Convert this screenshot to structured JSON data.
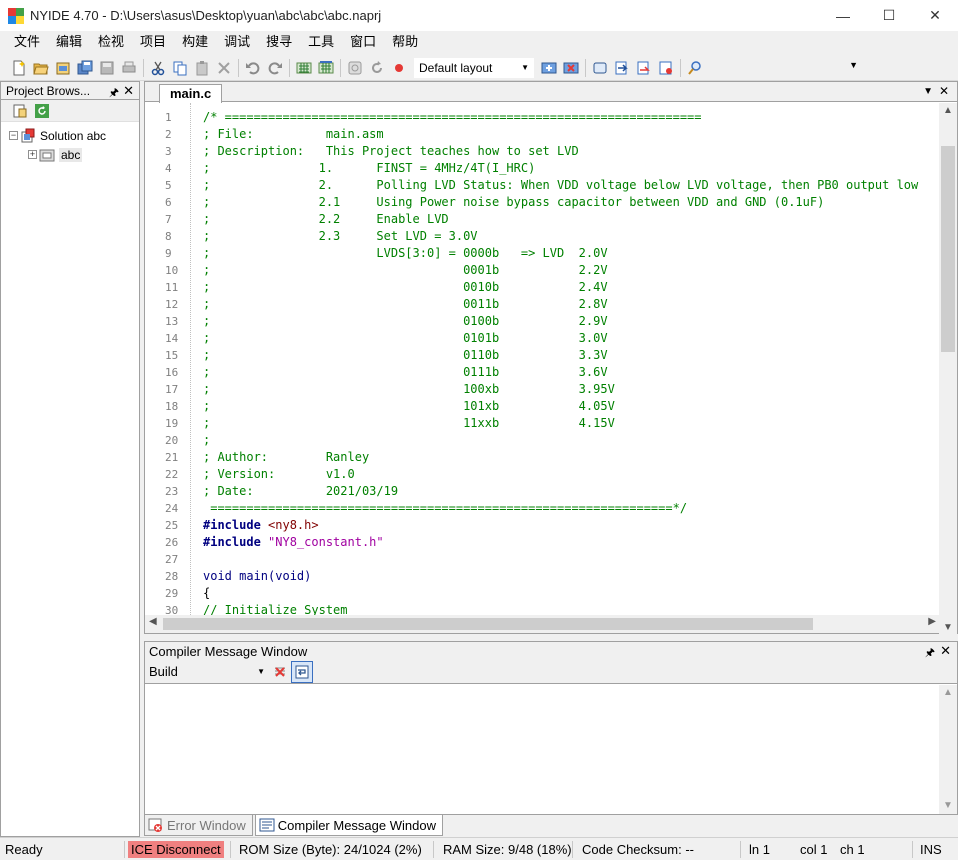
{
  "window": {
    "title": "NYIDE 4.70 - D:\\Users\\asus\\Desktop\\yuan\\abc\\abc\\abc.naprj",
    "minimize": "—",
    "maximize": "☐",
    "close": "✕"
  },
  "menu": [
    "文件",
    "编辑",
    "检视",
    "项目",
    "构建",
    "调试",
    "搜寻",
    "工具",
    "窗口",
    "帮助"
  ],
  "toolbar": {
    "layout_select": "Default layout",
    "icons": [
      "new-file-icon",
      "open-folder-icon",
      "open-project-icon",
      "save-all-icon",
      "save-icon",
      "print-icon",
      "cut-icon",
      "copy-icon",
      "paste-icon",
      "delete-icon",
      "undo-icon",
      "redo-icon",
      "build-icon",
      "rebuild-icon",
      "stop-icon",
      "reset-icon",
      "record-icon",
      "layout-save-icon",
      "layout-delete-icon",
      "window-icon",
      "step-into-icon",
      "step-over-icon",
      "step-out-icon",
      "find-icon"
    ]
  },
  "project_browser": {
    "title": "Project Brows...",
    "pin": "🖈",
    "close": "✕",
    "tree": [
      {
        "label": "Solution abc",
        "expander": "−"
      },
      {
        "label": "abc",
        "expander": "+"
      }
    ]
  },
  "editor": {
    "tab_label": "main.c",
    "tab_dropdown": "▼",
    "tab_close": "✕",
    "lines": [
      {
        "n": "1",
        "parts": [
          {
            "t": "/* ==================================================================",
            "c": "cm"
          }
        ]
      },
      {
        "n": "2",
        "parts": [
          {
            "t": "; File:          main.asm",
            "c": "cm"
          }
        ]
      },
      {
        "n": "3",
        "parts": [
          {
            "t": "; Description:   This Project teaches how to set LVD",
            "c": "cm"
          }
        ]
      },
      {
        "n": "4",
        "parts": [
          {
            "t": ";               1.      FINST = 4MHz/4T(I_HRC)",
            "c": "cm"
          }
        ]
      },
      {
        "n": "5",
        "parts": [
          {
            "t": ";               2.      Polling LVD Status: When VDD voltage below LVD voltage, then PB0 output low",
            "c": "cm"
          }
        ]
      },
      {
        "n": "6",
        "parts": [
          {
            "t": ";               2.1     Using Power noise bypass capacitor between VDD and GND (0.1uF)",
            "c": "cm"
          }
        ]
      },
      {
        "n": "7",
        "parts": [
          {
            "t": ";               2.2     Enable LVD",
            "c": "cm"
          }
        ]
      },
      {
        "n": "8",
        "parts": [
          {
            "t": ";               2.3     Set LVD = 3.0V",
            "c": "cm"
          }
        ]
      },
      {
        "n": "9",
        "parts": [
          {
            "t": ";                       LVDS[3:0] = 0000b   => LVD  2.0V",
            "c": "cm"
          }
        ]
      },
      {
        "n": "10",
        "parts": [
          {
            "t": ";                                   0001b           2.2V",
            "c": "cm"
          }
        ]
      },
      {
        "n": "11",
        "parts": [
          {
            "t": ";                                   0010b           2.4V",
            "c": "cm"
          }
        ]
      },
      {
        "n": "12",
        "parts": [
          {
            "t": ";                                   0011b           2.8V",
            "c": "cm"
          }
        ]
      },
      {
        "n": "13",
        "parts": [
          {
            "t": ";                                   0100b           2.9V",
            "c": "cm"
          }
        ]
      },
      {
        "n": "14",
        "parts": [
          {
            "t": ";                                   0101b           3.0V",
            "c": "cm"
          }
        ]
      },
      {
        "n": "15",
        "parts": [
          {
            "t": ";                                   0110b           3.3V",
            "c": "cm"
          }
        ]
      },
      {
        "n": "16",
        "parts": [
          {
            "t": ";                                   0111b           3.6V",
            "c": "cm"
          }
        ]
      },
      {
        "n": "17",
        "parts": [
          {
            "t": ";                                   100xb           3.95V",
            "c": "cm"
          }
        ]
      },
      {
        "n": "18",
        "parts": [
          {
            "t": ";                                   101xb           4.05V",
            "c": "cm"
          }
        ]
      },
      {
        "n": "19",
        "parts": [
          {
            "t": ";                                   11xxb           4.15V",
            "c": "cm"
          }
        ]
      },
      {
        "n": "20",
        "parts": [
          {
            "t": ";",
            "c": "cm"
          }
        ]
      },
      {
        "n": "21",
        "parts": [
          {
            "t": "; Author:        Ranley",
            "c": "cm"
          }
        ]
      },
      {
        "n": "22",
        "parts": [
          {
            "t": "; Version:       v1.0",
            "c": "cm"
          }
        ]
      },
      {
        "n": "23",
        "parts": [
          {
            "t": "; Date:          2021/03/19",
            "c": "cm"
          }
        ]
      },
      {
        "n": "24",
        "parts": [
          {
            "t": " ================================================================*/",
            "c": "cm"
          }
        ]
      },
      {
        "n": "25",
        "parts": [
          {
            "t": "#include ",
            "c": "pp"
          },
          {
            "t": "<ny8.h>",
            "c": "ang"
          }
        ]
      },
      {
        "n": "26",
        "parts": [
          {
            "t": "#include ",
            "c": "pp"
          },
          {
            "t": "\"NY8_constant.h\"",
            "c": "str"
          }
        ]
      },
      {
        "n": "27",
        "parts": [
          {
            "t": "",
            "c": "tx"
          }
        ]
      },
      {
        "n": "28",
        "parts": [
          {
            "t": "void main(void)",
            "c": "kw"
          }
        ]
      },
      {
        "n": "29",
        "parts": [
          {
            "t": "{",
            "c": "tx"
          }
        ]
      },
      {
        "n": "30",
        "parts": [
          {
            "t": "// Initialize System",
            "c": "cm"
          }
        ]
      }
    ]
  },
  "compiler": {
    "title": "Compiler Message Window",
    "pin": "🖈",
    "close": "✕",
    "filter": "Build",
    "messages": []
  },
  "bottom_tabs": [
    {
      "label": "Error Window",
      "active": false
    },
    {
      "label": "Compiler Message Window",
      "active": true
    }
  ],
  "status": {
    "ready": "Ready",
    "ice": "ICE Disconnect",
    "rom": "ROM Size (Byte): 24/1024 (2%)",
    "ram": "RAM Size: 9/48 (18%)",
    "checksum": "Code Checksum: --",
    "line": "ln 1",
    "col": "col 1",
    "ch": "ch 1",
    "mode": "INS"
  }
}
